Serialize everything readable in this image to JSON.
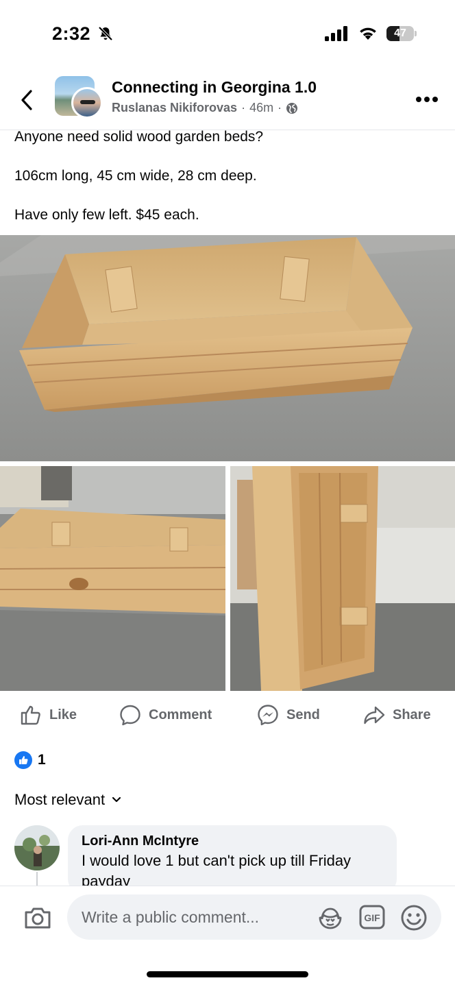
{
  "status_bar": {
    "time": "2:32",
    "battery_level": "47",
    "battery_fraction": 0.47
  },
  "header": {
    "group_name": "Connecting in Georgina 1.0",
    "author": "Ruslanas Nikiforovas",
    "time_ago": "46m",
    "separator": "·",
    "icons": [
      "back-chevron-icon",
      "globe-icon",
      "more-options-icon"
    ]
  },
  "post": {
    "lines": [
      "Anyone need solid wood garden beds?",
      "106cm long, 45 cm wide, 28 cm deep.",
      "Have only few left. $45 each."
    ]
  },
  "actions": {
    "like": "Like",
    "comment": "Comment",
    "send": "Send",
    "share": "Share"
  },
  "reactions": {
    "count": "1"
  },
  "comments": {
    "sort_label": "Most relevant",
    "items": [
      {
        "author": "Lori-Ann McIntyre",
        "text": "I would love 1 but can't pick up till Friday payday"
      }
    ]
  },
  "composer": {
    "placeholder": "Write a public comment...",
    "gif_label": "GIF"
  },
  "colors": {
    "brand_blue": "#1877f2",
    "secondary_text": "#65676b",
    "bubble_bg": "#f0f2f5"
  }
}
